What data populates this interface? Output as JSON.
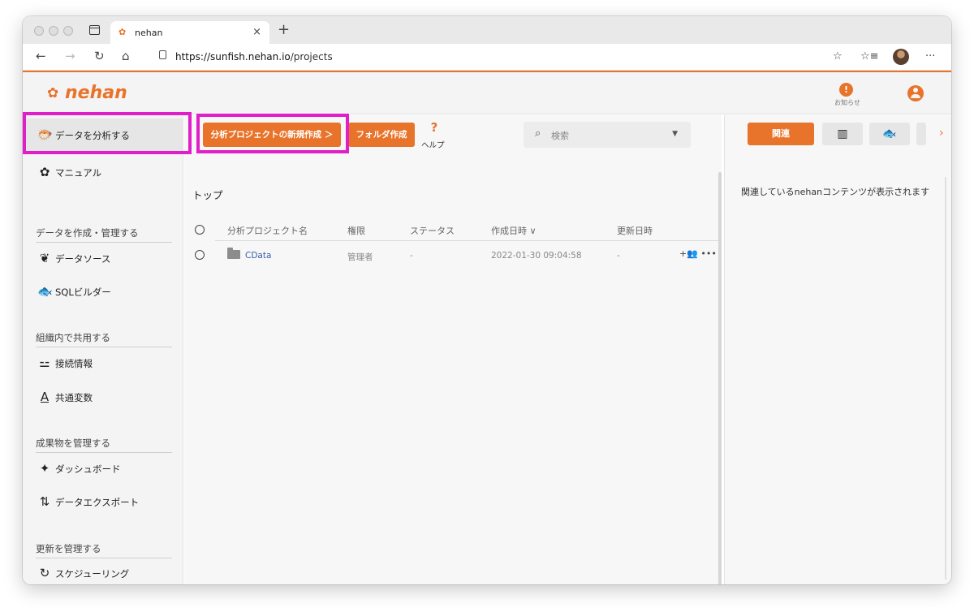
{
  "browser": {
    "tab_title": "nehan",
    "tab_favicon": "nehan-fish-icon",
    "tab_close": "×",
    "new_tab": "+",
    "url_host": "https://sunfish.nehan.io",
    "url_path": "/projects",
    "nav": {
      "back": "←",
      "forward": "→",
      "reload": "↻",
      "home": "⌂"
    },
    "right_icons": {
      "favorites_add": "☆",
      "favorites": "☆≡",
      "more": "···"
    }
  },
  "app": {
    "brand": "nehan",
    "brand_color": "#e8732a",
    "header": {
      "notice_icon": "!",
      "notice_label": "お知らせ"
    }
  },
  "sidebar": {
    "items": [
      {
        "icon": "analysis-icon",
        "glyph": "🐡",
        "label": "データを分析する"
      },
      {
        "icon": "manual-icon",
        "glyph": "✿",
        "label": "マニュアル"
      }
    ],
    "sections": [
      {
        "title": "データを作成・管理する",
        "items": [
          {
            "icon": "datasource-icon",
            "glyph": "❦",
            "label": "データソース"
          },
          {
            "icon": "sql-builder-icon",
            "glyph": "🐟",
            "label": "SQLビルダー"
          }
        ]
      },
      {
        "title": "組織内で共用する",
        "items": [
          {
            "icon": "connection-icon",
            "glyph": "⚍",
            "label": "接続情報"
          },
          {
            "icon": "variable-icon",
            "glyph": "A",
            "label": "共通変数"
          }
        ]
      },
      {
        "title": "成果物を管理する",
        "items": [
          {
            "icon": "dashboard-icon",
            "glyph": "✦",
            "label": "ダッシュボード"
          },
          {
            "icon": "export-icon",
            "glyph": "⇅",
            "label": "データエクスポート"
          }
        ]
      },
      {
        "title": "更新を管理する",
        "items": [
          {
            "icon": "schedule-icon",
            "glyph": "↻",
            "label": "スケジューリング"
          }
        ]
      }
    ]
  },
  "main": {
    "new_project_button": "分析プロジェクトの新規作成 ＞",
    "new_folder_button": "フォルダ作成",
    "help_label": "ヘルプ",
    "search_placeholder": "検索",
    "breadcrumb": "トップ",
    "columns": [
      "分析プロジェクト名",
      "権限",
      "ステータス",
      "作成日時 ∨",
      "更新日時"
    ],
    "rows": [
      {
        "name": "CData",
        "permission": "管理者",
        "status": "-",
        "created": "2022-01-30 09:04:58",
        "updated": "-"
      }
    ],
    "row_actions": "+👥  •••"
  },
  "right_panel": {
    "related_button": "関連",
    "table_button": "▥",
    "fish_button": "🐟",
    "more_chevron": "›",
    "empty_message": "関連しているnehanコンテンツが表示されます"
  }
}
